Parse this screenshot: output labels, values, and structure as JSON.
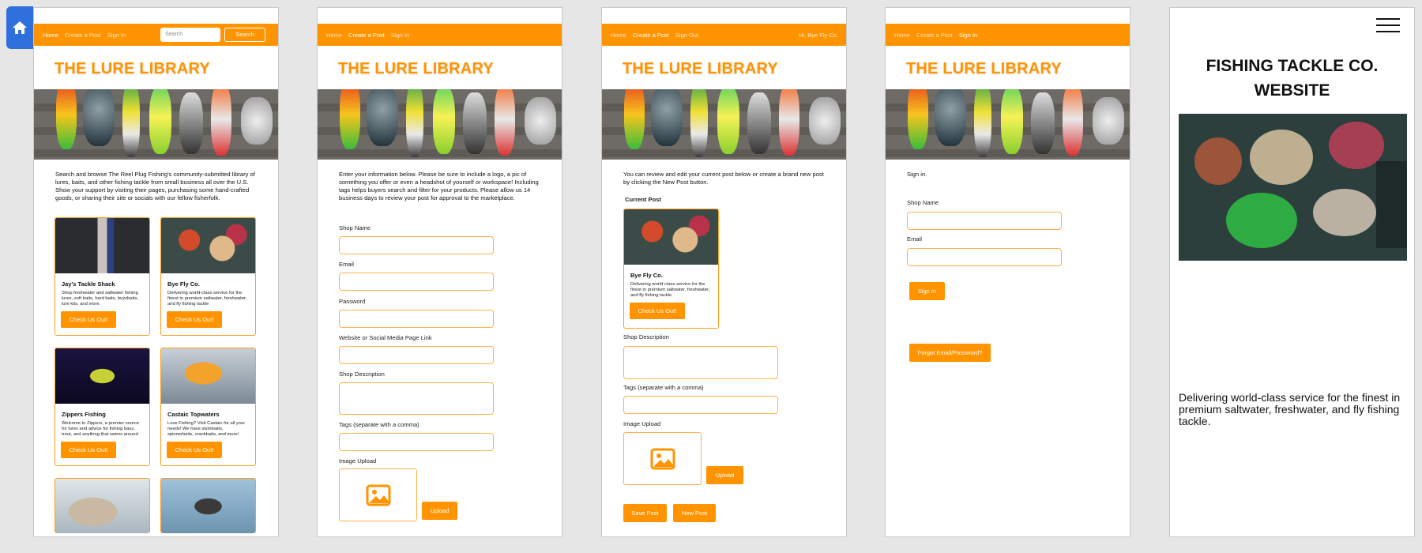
{
  "brand": "THE LURE LIBRARY",
  "screen1": {
    "nav": [
      "Home",
      "Create a Post",
      "Sign In"
    ],
    "search_placeholder": "Search",
    "search_button": "Search",
    "intro": "Search and browse The Reel Plug Fishing's community-submitted library of lures, baits, and other fishing tackle from small business all over the U.S. Show your support by visiting their pages, purchasing some hand-crafted goods, or sharing their site or socials with our fellow fisherfolk.",
    "cards": [
      {
        "title": "Jay's Tackle Shack",
        "desc": "Shop freshwater and saltwater fishing lures, soft baits, hard baits, buzzbaits, lure kits, and more.",
        "cta": "Check Us Out!"
      },
      {
        "title": "Bye Fly Co.",
        "desc": "Delivering world-class service for the finest in premium saltwater, freshwater, and fly fishing tackle",
        "cta": "Check Us Out!"
      },
      {
        "title": "Zippers Fishing",
        "desc": "Welcome to Zippers, a premier source for lures and advice for fishing bass, trout, and anything that swims around",
        "cta": "Check Us Out!"
      },
      {
        "title": "Castaic Topwaters",
        "desc": "Love Fishing? Visit Castaic for all your needs! We have swimbaits, spinnerbaits, crankbaits, and more!",
        "cta": "Check Us Out!"
      }
    ]
  },
  "screen2": {
    "nav": [
      "Home",
      "Create a Post",
      "Sign In"
    ],
    "intro": "Enter your information below. Please be sure to include a logo, a pic of something you offer or even a headshot of yourself or workspace! Including tags helps buyers search and filter for your products. Please allow us 14 business days to review your post for approval to the marketplace.",
    "fields": [
      "Shop Name",
      "Email",
      "Password",
      "Website or Social Media Page Link",
      "Shop Description",
      "Tags (separate with a comma)"
    ],
    "image_label": "Image Upload",
    "upload_button": "Upload"
  },
  "screen3": {
    "nav": [
      "Home",
      "Create a Post",
      "Sign Out"
    ],
    "greeting": "Hi, Bye Fly Co.",
    "intro": "You can review and edit your current post below or create a brand new post by clicking the New Post button.",
    "current_post_label": "Current Post",
    "card": {
      "title": "Bye Fly Co.",
      "desc": "Delivering world-class service for the finest in premium saltwater, freshwater, and fly fishing tackle",
      "cta": "Check Us Out!"
    },
    "fields": [
      "Shop Description",
      "Tags (separate with a comma)"
    ],
    "image_label": "Image Upload",
    "upload_button": "Upload",
    "save_button": "Save Post",
    "new_button": "New Post"
  },
  "screen4": {
    "nav": [
      "Home",
      "Create a Post",
      "Sign In"
    ],
    "intro": "Sign in.",
    "fields": [
      "Shop Name",
      "Email"
    ],
    "signin_button": "Sign In",
    "forgot_button": "Forgot Email/Password?"
  },
  "screen5": {
    "title_line1": "FISHING TACKLE CO.",
    "title_line2": "WEBSITE",
    "copy": "Delivering world-class service for the finest in premium saltwater, freshwater, and fly fishing tackle."
  },
  "colors": {
    "accent": "#ff9400",
    "field_border": "#ffb14a",
    "home_tab": "#2f6fdc"
  },
  "icons": [
    "home-icon",
    "image-placeholder-icon",
    "hamburger-menu-icon"
  ]
}
